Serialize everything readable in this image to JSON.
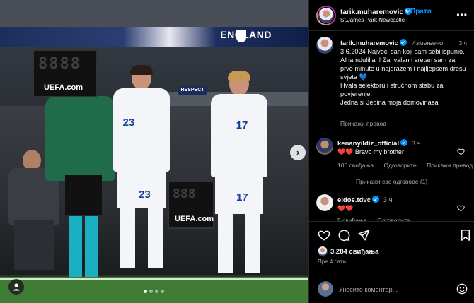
{
  "photo": {
    "board_brand": "UEFA.com",
    "banner_text": "ENGLAND",
    "ad_text": "RESPECT",
    "player_left_number": "23",
    "player_right_number": "17",
    "board_digits": "8888",
    "board2_digits": "888",
    "carousel_total": 4,
    "carousel_active": 1
  },
  "post": {
    "username": "tarik.muharemovic",
    "follow_label": "Прати",
    "location": "St.James Park Newcastle",
    "edited_label": "Измењено",
    "time": "3 ч",
    "caption_lines": [
      "3.6.2024 Najveći san koji sam sebi ispunio.",
      "Alhamdulillah! Zahvalan i sretan sam za prve minute u najdrazem i najljepsem dresu svjeta 💙",
      "Hvala selektoru i stručnom stabu za povjerenje.",
      "Jedna si Jedina moja domovinaва"
    ],
    "translate_label": "Прикажи превод"
  },
  "comments": [
    {
      "username": "kenanyildiz_official",
      "time": "3 ч",
      "text": "❤️❤️ Bravo my brother",
      "likes": "106 свиђања",
      "reply": "Одговорите",
      "translate": "Прикажи превод",
      "view_replies": "Прикажи све одговоре (1)"
    },
    {
      "username": "eldos.tdvc",
      "time": "3 ч",
      "text": "❤️❤️",
      "likes": "5 свиђања",
      "reply": "Одговорите"
    }
  ],
  "actions": {
    "likes": "3.284 свиђања",
    "ago": "Пре 4 сати",
    "comment_placeholder": "Унесите коментар..."
  },
  "icons": {
    "like": "heart-icon",
    "comment": "comment-icon",
    "share": "share-icon",
    "save": "bookmark-icon",
    "emoji": "emoji-icon",
    "more": "more-options-icon",
    "mute": "user-tag-icon"
  },
  "colors": {
    "accent": "#0095f6",
    "heart": "#ff3040",
    "muted": "#a8a8a8",
    "background": "#000000"
  }
}
